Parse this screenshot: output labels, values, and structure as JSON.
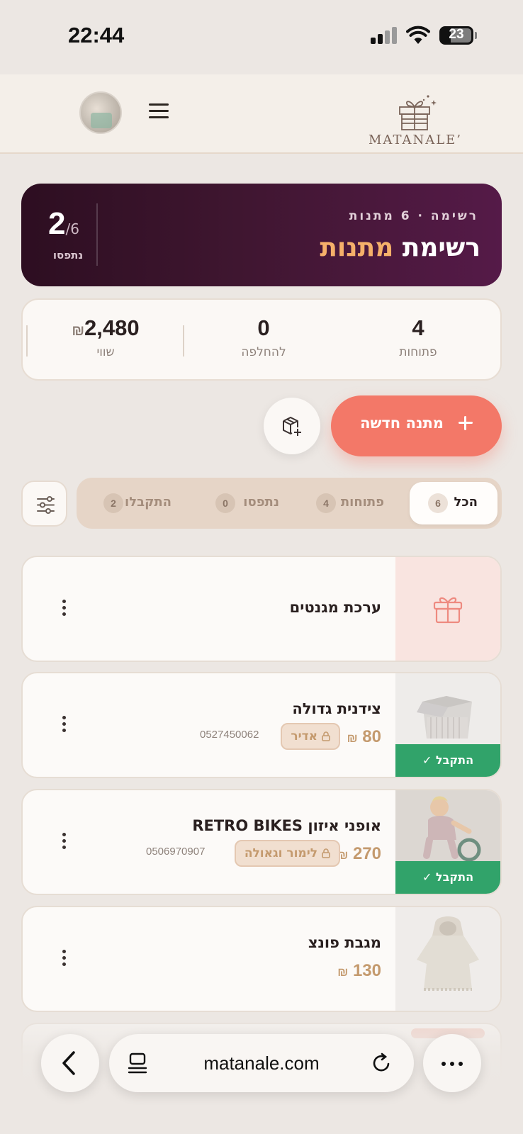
{
  "status_bar": {
    "time": "22:44",
    "battery": "23"
  },
  "header": {
    "logo_text": "MATANALE’"
  },
  "hero": {
    "subtitle": "רשימה · 6 מתנות",
    "title_main": "רשימת ",
    "title_accent": "מתנות",
    "count_taken": "2",
    "count_total": "/6",
    "count_label": "נתפסו"
  },
  "stats": {
    "open_value": "4",
    "open_label": "פתוחות",
    "exchange_value": "0",
    "exchange_label": "להחלפה",
    "worth_value": "2,480",
    "worth_currency": "₪",
    "worth_label": "שווי"
  },
  "actions": {
    "new_gift_label": "מתנה חדשה"
  },
  "tabs": [
    {
      "label": "הכל",
      "count": "6"
    },
    {
      "label": "פתוחות",
      "count": "4"
    },
    {
      "label": "נתפסו",
      "count": "0"
    },
    {
      "label": "התקבלו",
      "count": "2"
    }
  ],
  "items": [
    {
      "title": "ערכת מגנטים"
    },
    {
      "title": "צידנית גדולה",
      "price": "80",
      "currency": "₪",
      "reserver": "אדיר",
      "phone": "0527450062",
      "status": "התקבל ✓"
    },
    {
      "title": "אופני איזון RETRO BIKES",
      "price": "270",
      "currency": "₪",
      "reserver": "לימור וגאולה",
      "phone": "0506970907",
      "status": "התקבל ✓"
    },
    {
      "title": "מגבת פונצ",
      "price": "130",
      "currency": "₪"
    }
  ],
  "browser": {
    "url": "matanale.com"
  },
  "colors": {
    "accent": "#f37868",
    "hero_dark": "#3f1630",
    "price": "#c49a6e",
    "received": "#31a36a"
  }
}
